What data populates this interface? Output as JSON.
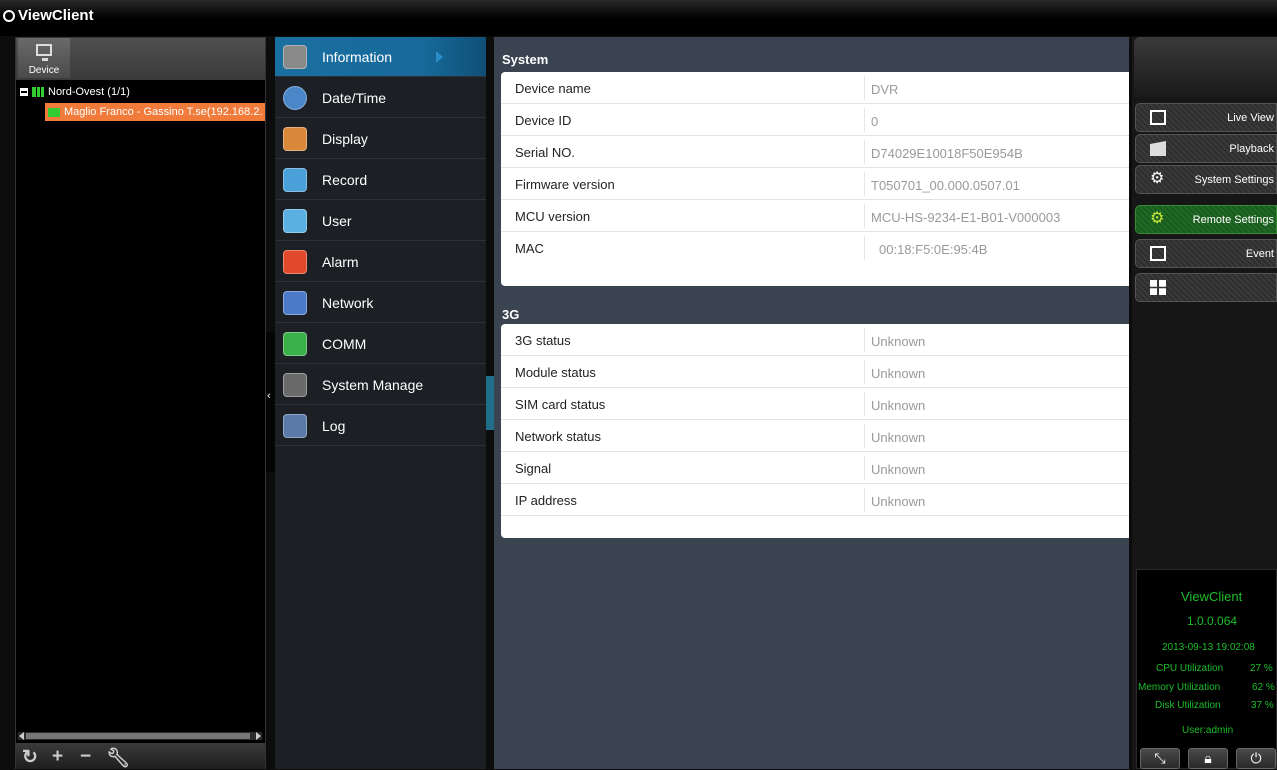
{
  "app": {
    "title": "ViewClient"
  },
  "device_panel": {
    "tab_label": "Device",
    "tree_root": "Nord-Ovest (1/1)",
    "tree_item": "Maglio Franco - Gassino T.se(192.168.2."
  },
  "menu": {
    "items": [
      {
        "label": "Information",
        "icon": "gear-icon",
        "color": "#8a8a8a"
      },
      {
        "label": "Date/Time",
        "icon": "clock-icon",
        "color": "#4a86c8"
      },
      {
        "label": "Display",
        "icon": "display-icon",
        "color": "#d9873a"
      },
      {
        "label": "Record",
        "icon": "record-icon",
        "color": "#4aa0d8"
      },
      {
        "label": "User",
        "icon": "user-icon",
        "color": "#5ab0e0"
      },
      {
        "label": "Alarm",
        "icon": "alarm-icon",
        "color": "#e04a2a"
      },
      {
        "label": "Network",
        "icon": "network-icon",
        "color": "#4a7ac8"
      },
      {
        "label": "COMM",
        "icon": "comm-icon",
        "color": "#3ab04a"
      },
      {
        "label": "System Manage",
        "icon": "system-manage-icon",
        "color": "#6a6a6a"
      },
      {
        "label": "Log",
        "icon": "log-icon",
        "color": "#5a7aa8"
      }
    ]
  },
  "system_section": {
    "title": "System",
    "rows": [
      {
        "key": "Device name",
        "value": "DVR"
      },
      {
        "key": "Device ID",
        "value": "0"
      },
      {
        "key": "Serial NO.",
        "value": "D74029E10018F50E954B"
      },
      {
        "key": "Firmware version",
        "value": "T050701_00.000.0507.01"
      },
      {
        "key": "MCU version",
        "value": "MCU-HS-9234-E1-B01-V000003"
      },
      {
        "key": "MAC",
        "value": "00:18:F5:0E:95:4B"
      }
    ]
  },
  "g3_section": {
    "title": "3G",
    "rows": [
      {
        "key": "3G status",
        "value": "Unknown"
      },
      {
        "key": "Module status",
        "value": "Unknown"
      },
      {
        "key": "SIM card status",
        "value": "Unknown"
      },
      {
        "key": "Network status",
        "value": "Unknown"
      },
      {
        "key": "Signal",
        "value": "Unknown"
      },
      {
        "key": "IP address",
        "value": "Unknown"
      }
    ]
  },
  "nav": {
    "live_view": "Live View",
    "playback": "Playback",
    "system_settings": "System Settings",
    "remote_settings": "Remote Settings",
    "event": "Event"
  },
  "status": {
    "app_name": "ViewClient",
    "version": "1.0.0.064",
    "datetime": "2013-09-13 19:02:08",
    "cpu_label": "CPU Utilization",
    "cpu_value": "27 %",
    "memory_label": "Memory Utilization",
    "memory_value": "62 %",
    "disk_label": "Disk Utilization",
    "disk_value": "37 %",
    "user": "User:admin"
  },
  "colors": {
    "accent": "#1a6fa1",
    "tree_selected": "#f07b3a",
    "status_text": "#1dbd2a",
    "remote_settings_active": "#1f6a24"
  }
}
